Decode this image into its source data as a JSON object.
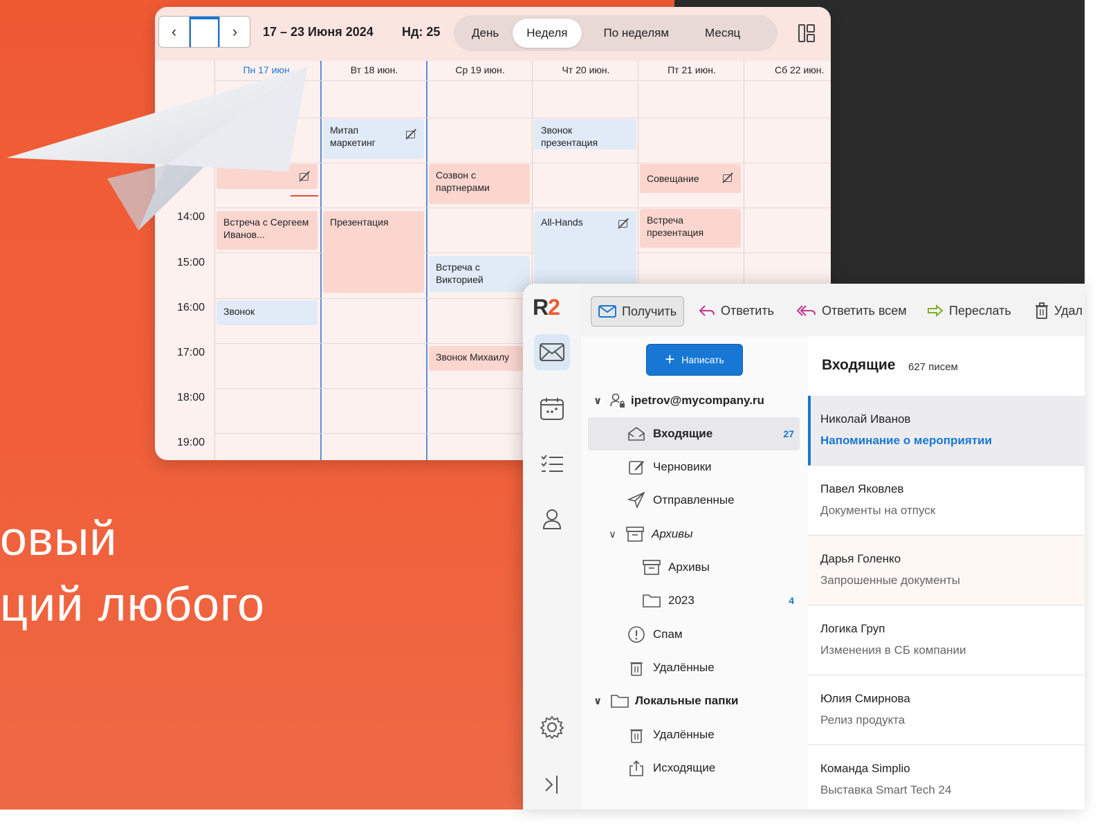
{
  "calendar": {
    "range": "17 – 23 Июня 2024",
    "week": "Нд: 25",
    "views": [
      "День",
      "Неделя",
      "По неделям",
      "Месяц"
    ],
    "active_view": "Неделя",
    "days": [
      "Пн 17 июн.",
      "Вт 18 июн.",
      "Ср 19 июн.",
      "Чт 20 июн.",
      "Пт 21 июн.",
      "Сб 22 июн."
    ],
    "hours": [
      "14:00",
      "15:00",
      "16:00",
      "17:00",
      "18:00",
      "19:00"
    ],
    "events": {
      "e1": "Митап маркетинг",
      "e2": "Звонок презентация",
      "e3": "Созвон с партнерами",
      "e4": "Совещание",
      "e5": "Встреча с Сергеем Иванов...",
      "e6": "Презентация",
      "e7": "All-Hands",
      "e8": "Встреча презентация",
      "e9": "Встреча с Викторией",
      "e10": "Звонок",
      "e11": "Звонок Михаилу"
    }
  },
  "headline": {
    "line1": "овый",
    "line2": "ций любого"
  },
  "mail": {
    "logo_r": "R",
    "logo_2": "2",
    "toolbar": {
      "receive": "Получить",
      "reply": "Ответить",
      "reply_all": "Ответить всем",
      "forward": "Переслать",
      "delete": "Удал"
    },
    "compose": "Написать",
    "account": "ipetrov@mycompany.ru",
    "folders": {
      "inbox": "Входящие",
      "inbox_count": "27",
      "drafts": "Черновики",
      "sent": "Отправленные",
      "archives_group": "Архивы",
      "archives": "Архивы",
      "y2023": "2023",
      "y2023_count": "4",
      "spam": "Спам",
      "deleted": "Удалённые",
      "local_group": "Локальные папки",
      "local_deleted": "Удалённые",
      "outbox": "Исходящие"
    },
    "list": {
      "title": "Входящие",
      "count": "627 писем",
      "messages": [
        {
          "from": "Николай Иванов",
          "subject": "Напоминание о мероприятии"
        },
        {
          "from": "Павел Яковлев",
          "subject": "Документы на отпуск"
        },
        {
          "from": "Дарья Голенко",
          "subject": "Запрошенные документы"
        },
        {
          "from": "Логика Груп",
          "subject": "Изменения в СБ компании"
        },
        {
          "from": "Юлия Смирнова",
          "subject": "Релиз продукта"
        },
        {
          "from": "Команда Simplio",
          "subject": "Выставка Smart Tech 24"
        }
      ]
    }
  },
  "colors": {
    "accent": "#1877d4",
    "brand": "#ef5a33"
  }
}
